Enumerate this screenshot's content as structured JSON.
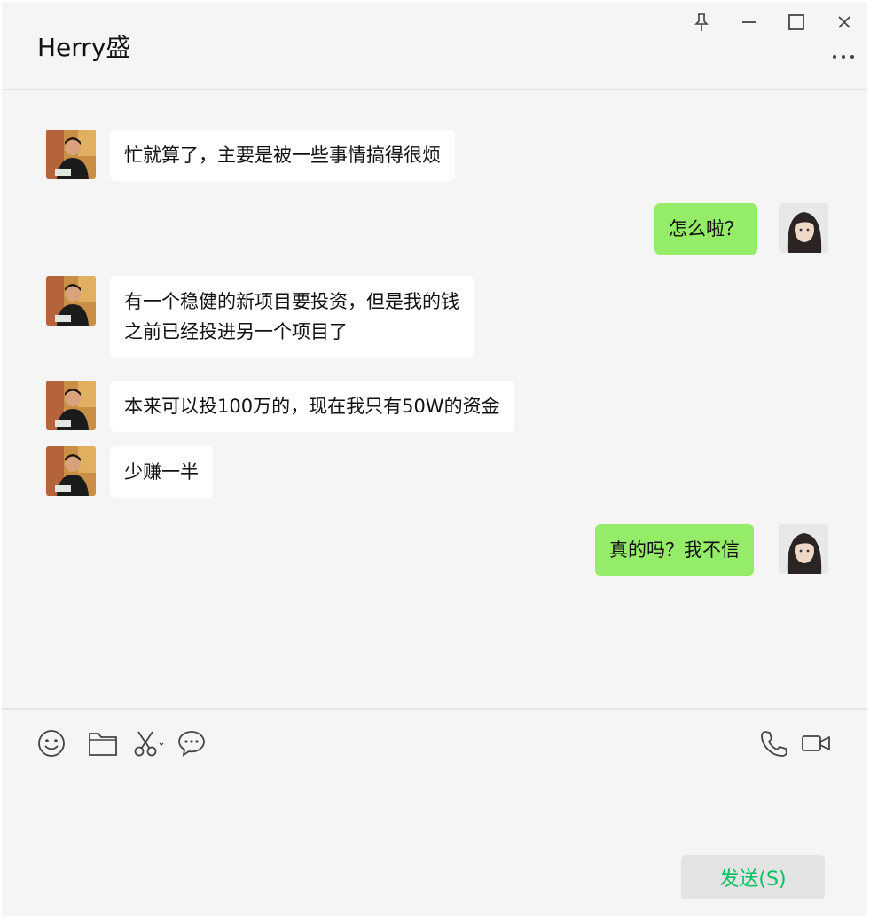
{
  "window": {
    "title": "Herry盛"
  },
  "icons": {
    "pin": "pin-icon",
    "minimize": "minimize-icon",
    "maximize": "maximize-icon",
    "close": "close-icon",
    "more": "more-icon",
    "emoji": "emoji-icon",
    "file": "folder-icon",
    "screenshot": "scissors-icon",
    "chat_history": "chat-bubble-icon",
    "voice_call": "phone-icon",
    "video_call": "video-camera-icon"
  },
  "colors": {
    "my_bubble": "#95ec69",
    "their_bubble": "#ffffff",
    "send_text": "#07c160",
    "background": "#f5f5f5"
  },
  "messages": [
    {
      "sender": "them",
      "lines": [
        "忙就算了，主要是被一些事情搞得很烦"
      ]
    },
    {
      "sender": "me",
      "lines": [
        "怎么啦？"
      ]
    },
    {
      "sender": "them",
      "lines": [
        "有一个稳健的新项目要投资，但是我的钱",
        "之前已经投进另一个项目了"
      ]
    },
    {
      "sender": "them",
      "lines": [
        "本来可以投100万的，现在我只有50W的资金"
      ]
    },
    {
      "sender": "them",
      "lines": [
        "少赚一半"
      ]
    },
    {
      "sender": "me",
      "lines": [
        "真的吗？我不信"
      ]
    }
  ],
  "composer": {
    "send_label": "发送(S)"
  }
}
